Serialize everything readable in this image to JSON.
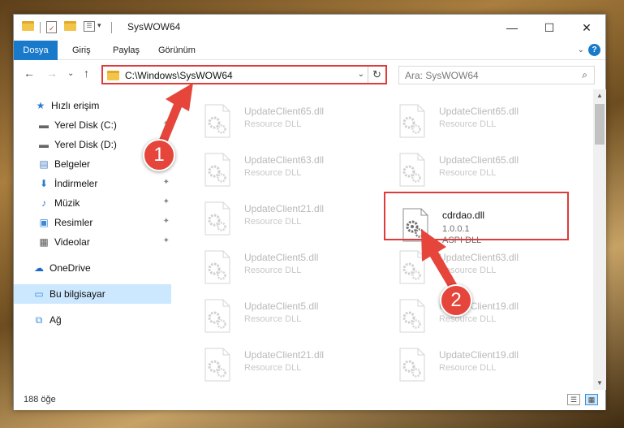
{
  "window": {
    "title": "SysWOW64",
    "minimize_label": "—",
    "maximize_label": "☐",
    "close_label": "✕"
  },
  "ribbon": {
    "tabs": [
      "Dosya",
      "Giriş",
      "Paylaş",
      "Görünüm"
    ],
    "expand_glyph": "⌄",
    "help_glyph": "?"
  },
  "nav": {
    "back_glyph": "←",
    "forward_glyph": "→",
    "recent_glyph": "⌄",
    "up_glyph": "↑",
    "address": "C:\\Windows\\SysWOW64",
    "dropdown_glyph": "⌄",
    "refresh_glyph": "↻",
    "search_placeholder": "Ara: SysWOW64",
    "search_glyph": "⌕"
  },
  "sidebar": {
    "items": [
      {
        "label": "Hızlı erişim",
        "icon": "star-icon",
        "glyph": "★",
        "color": "#2b7cd3",
        "pinned": false,
        "selected": false
      },
      {
        "label": "Yerel Disk (C:)",
        "icon": "drive-icon",
        "glyph": "▬",
        "color": "#666666",
        "pinned": true,
        "selected": false
      },
      {
        "label": "Yerel Disk (D:)",
        "icon": "drive-icon",
        "glyph": "▬",
        "color": "#666666",
        "pinned": true,
        "selected": false
      },
      {
        "label": "Belgeler",
        "icon": "documents-icon",
        "glyph": "▤",
        "color": "#4a7fbf",
        "pinned": true,
        "selected": false
      },
      {
        "label": "İndirmeler",
        "icon": "downloads-icon",
        "glyph": "⬇",
        "color": "#2b7cd3",
        "pinned": true,
        "selected": false
      },
      {
        "label": "Müzik",
        "icon": "music-icon",
        "glyph": "♪",
        "color": "#2b7cd3",
        "pinned": true,
        "selected": false
      },
      {
        "label": "Resimler",
        "icon": "pictures-icon",
        "glyph": "▣",
        "color": "#3b8ad8",
        "pinned": true,
        "selected": false
      },
      {
        "label": "Videolar",
        "icon": "videos-icon",
        "glyph": "▦",
        "color": "#555555",
        "pinned": true,
        "selected": false
      },
      {
        "label": "OneDrive",
        "icon": "cloud-icon",
        "glyph": "☁",
        "color": "#1b6ac9",
        "pinned": false,
        "selected": false
      },
      {
        "label": "Bu bilgisayar",
        "icon": "computer-icon",
        "glyph": "▭",
        "color": "#3d8fd6",
        "pinned": false,
        "selected": true
      },
      {
        "label": "Ağ",
        "icon": "network-icon",
        "glyph": "⧉",
        "color": "#3d8fd6",
        "pinned": false,
        "selected": false
      }
    ],
    "pin_glyph": "📌"
  },
  "files": [
    {
      "name": "UpdateClient65.dll",
      "type": "Resource DLL",
      "col": 0,
      "row": 0
    },
    {
      "name": "UpdateClient65.dll",
      "type": "Resource DLL",
      "col": 1,
      "row": 0
    },
    {
      "name": "UpdateClient63.dll",
      "type": "Resource DLL",
      "col": 0,
      "row": 1
    },
    {
      "name": "UpdateClient65.dll",
      "type": "Resource DLL",
      "col": 1,
      "row": 1
    },
    {
      "name": "UpdateClient21.dll",
      "type": "Resource DLL",
      "col": 0,
      "row": 2
    },
    {
      "name": "UpdateClient5.dll",
      "type": "Resource DLL",
      "col": 0,
      "row": 3
    },
    {
      "name": "UpdateClient63.dll",
      "type": "Resource DLL",
      "col": 1,
      "row": 3
    },
    {
      "name": "UpdateClient5.dll",
      "type": "Resource DLL",
      "col": 0,
      "row": 4
    },
    {
      "name": "UpdateClient19.dll",
      "type": "Resource DLL",
      "col": 1,
      "row": 4
    },
    {
      "name": "UpdateClient21.dll",
      "type": "Resource DLL",
      "col": 0,
      "row": 5
    },
    {
      "name": "UpdateClient19.dll",
      "type": "Resource DLL",
      "col": 1,
      "row": 5
    }
  ],
  "highlighted_file": {
    "name": "cdrdao.dll",
    "version": "1.0.0.1",
    "type": "ASPI DLL"
  },
  "status": {
    "item_count": "188 öğe"
  },
  "annotations": {
    "step1": "1",
    "step2": "2",
    "color": "#e5453b"
  }
}
